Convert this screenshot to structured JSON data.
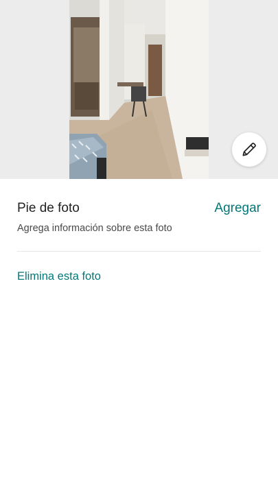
{
  "photo": {
    "subject": "apartment-interior-photo"
  },
  "edit_button": {
    "icon": "pencil-icon"
  },
  "caption": {
    "title": "Pie de foto",
    "add_label": "Agregar",
    "help_text": "Agrega información sobre esta foto"
  },
  "actions": {
    "delete_label": "Elimina esta foto"
  },
  "colors": {
    "accent": "#00787a",
    "text_primary": "#222222",
    "text_secondary": "#484848",
    "divider": "#e6e6e6",
    "photo_background": "#ececec"
  }
}
